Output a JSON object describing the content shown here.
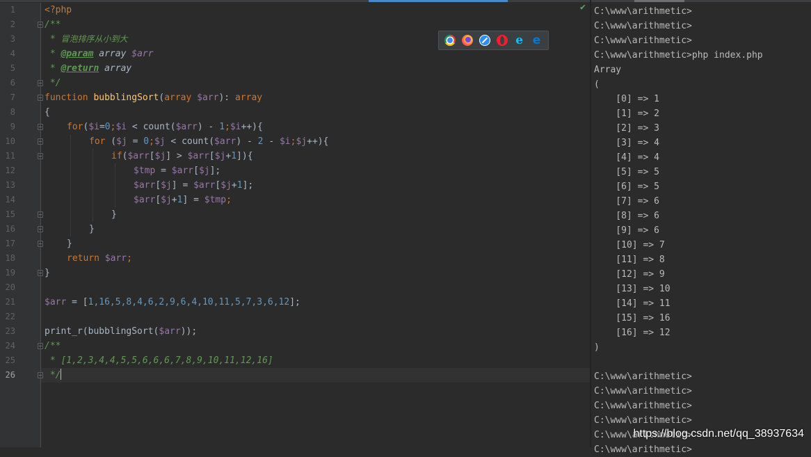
{
  "editor": {
    "current_line": 26,
    "line_numbers": [
      "1",
      "2",
      "3",
      "4",
      "5",
      "6",
      "7",
      "8",
      "9",
      "10",
      "11",
      "12",
      "13",
      "14",
      "15",
      "16",
      "17",
      "18",
      "19",
      "20",
      "21",
      "22",
      "23",
      "24",
      "25",
      "26"
    ],
    "code": {
      "l1": "<?php",
      "l2": "/**",
      "l3_prefix": " * ",
      "l3_text": "冒泡排序从小到大",
      "l4_prefix": " * ",
      "l4_tag": "@param",
      "l4_rest": " array ",
      "l4_var": "$arr",
      "l5_prefix": " * ",
      "l5_tag": "@return",
      "l5_rest": " array",
      "l6": " */",
      "l7_kw": "function",
      "l7_name": "bubblingSort",
      "l7_p1": "(",
      "l7_type": "array",
      "l7_var": "$arr",
      "l7_p2": "): ",
      "l7_ret": "array",
      "l8": "{",
      "l9_kw": "for",
      "l9_a": "(",
      "l9_v1": "$i",
      "l9_b": "=",
      "l9_n0": "0",
      "l9_c": ";",
      "l9_v2": "$i",
      "l9_d": " < count(",
      "l9_v3": "$arr",
      "l9_e": ") - ",
      "l9_n1": "1",
      "l9_f": ";",
      "l9_v4": "$i",
      "l9_g": "++){",
      "l10_kw": "for",
      "l10_a": " (",
      "l10_v1": "$j",
      "l10_b": " = ",
      "l10_n0": "0",
      "l10_c": ";",
      "l10_v2": "$j",
      "l10_d": " < count(",
      "l10_v3": "$arr",
      "l10_e": ") - ",
      "l10_n2": "2",
      "l10_f": " - ",
      "l10_v4": "$i",
      "l10_g": ";",
      "l10_v5": "$j",
      "l10_h": "++){",
      "l11_kw": "if",
      "l11_a": "(",
      "l11_v1": "$arr",
      "l11_b": "[",
      "l11_v2": "$j",
      "l11_c": "] > ",
      "l11_v3": "$arr",
      "l11_d": "[",
      "l11_v4": "$j",
      "l11_e": "+",
      "l11_n1": "1",
      "l11_f": "]){",
      "l12_v1": "$tmp",
      "l12_a": " = ",
      "l12_v2": "$arr",
      "l12_b": "[",
      "l12_v3": "$j",
      "l12_c": "];",
      "l13_v1": "$arr",
      "l13_a": "[",
      "l13_v2": "$j",
      "l13_b": "] = ",
      "l13_v3": "$arr",
      "l13_c": "[",
      "l13_v4": "$j",
      "l13_d": "+",
      "l13_n1": "1",
      "l13_e": "];",
      "l14_v1": "$arr",
      "l14_a": "[",
      "l14_v2": "$j",
      "l14_b": "+",
      "l14_n1": "1",
      "l14_c": "] = ",
      "l14_v3": "$tmp",
      "l14_d": ";",
      "l15": "}",
      "l16": "}",
      "l17": "}",
      "l18_kw": "return",
      "l18_sp": " ",
      "l18_var": "$arr",
      "l18_end": ";",
      "l19": "}",
      "l21_var": "$arr",
      "l21_a": " = [",
      "l21_nums": "1,16,5,8,4,6,2,9,6,4,10,11,5,7,3,6,12",
      "l21_b": "];",
      "l23_a": "print_r(bubblingSort(",
      "l23_var": "$arr",
      "l23_b": "));",
      "l24": "/**",
      "l25": " * [1,2,3,4,4,5,5,6,6,6,7,8,9,10,11,12,16]",
      "l26": " */"
    }
  },
  "browser_icons": [
    "chrome-icon",
    "firefox-icon",
    "safari-icon",
    "opera-icon",
    "ie-icon",
    "edge-icon"
  ],
  "browser_glyphs": {
    "ie": "e",
    "edge": "e"
  },
  "status_check": "✔",
  "terminal": {
    "lines": [
      "C:\\www\\arithmetic>",
      "C:\\www\\arithmetic>",
      "C:\\www\\arithmetic>",
      "C:\\www\\arithmetic>php index.php",
      "Array",
      "(",
      "    [0] => 1",
      "    [1] => 2",
      "    [2] => 3",
      "    [3] => 4",
      "    [4] => 4",
      "    [5] => 5",
      "    [6] => 5",
      "    [7] => 6",
      "    [8] => 6",
      "    [9] => 6",
      "    [10] => 7",
      "    [11] => 8",
      "    [12] => 9",
      "    [13] => 10",
      "    [14] => 11",
      "    [15] => 16",
      "    [16] => 12",
      ")",
      "",
      "C:\\www\\arithmetic>",
      "C:\\www\\arithmetic>",
      "C:\\www\\arithmetic>",
      "C:\\www\\arithmetic>",
      "C:\\www\\arithmetic>",
      "C:\\www\\arithmetic>"
    ]
  },
  "watermark": "https://blog.csdn.net/qq_38937634",
  "colors": {
    "background": "#2b2b2b",
    "keyword": "#cc7832",
    "function": "#ffc66d",
    "variable": "#9876aa",
    "number": "#6897bb",
    "comment": "#629755"
  }
}
